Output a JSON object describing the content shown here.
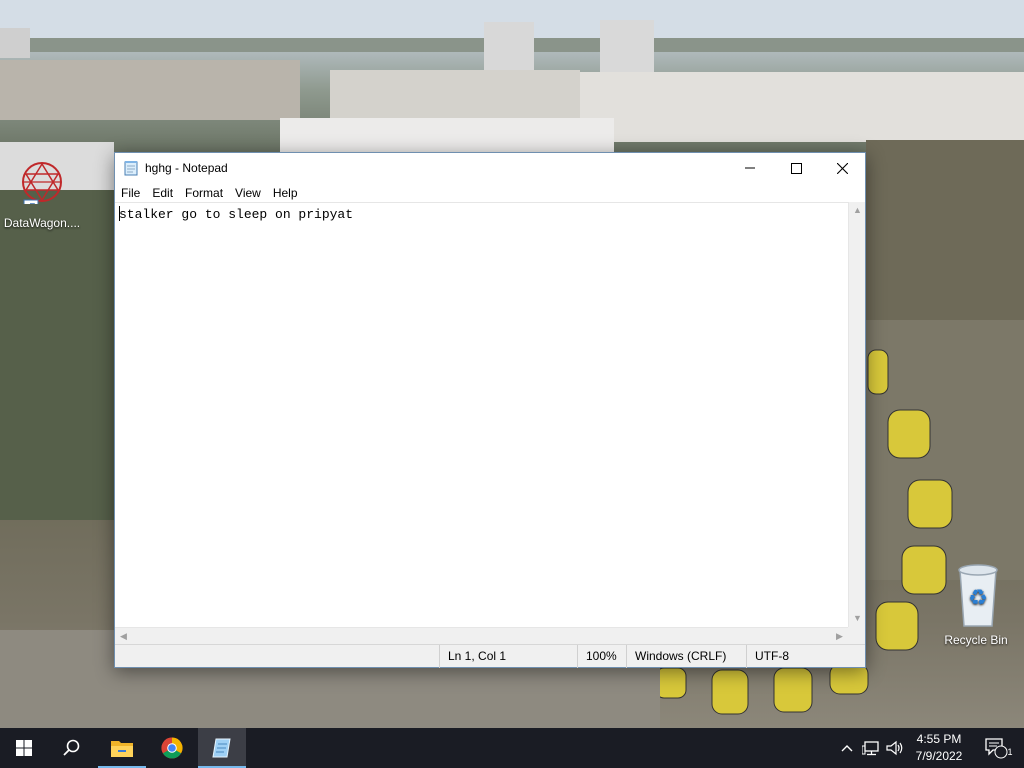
{
  "desktop": {
    "icons": [
      {
        "label": "DataWagon...."
      },
      {
        "label": "Recycle Bin"
      }
    ]
  },
  "window": {
    "title": "hghg - Notepad",
    "controls": {
      "minimize": "—",
      "maximize": "☐",
      "close": "✕"
    },
    "menu": [
      "File",
      "Edit",
      "Format",
      "View",
      "Help"
    ],
    "content": "stalker go to sleep on pripyat",
    "status": {
      "position": "Ln 1, Col 1",
      "zoom": "100%",
      "line_ending": "Windows (CRLF)",
      "encoding": "UTF-8"
    }
  },
  "taskbar": {
    "pinned": [
      "start-icon",
      "search-icon",
      "file-explorer-icon",
      "chrome-icon",
      "notepad-icon"
    ],
    "clock": {
      "time": "4:55 PM",
      "date": "7/9/2022"
    },
    "notifications_count": "1"
  }
}
